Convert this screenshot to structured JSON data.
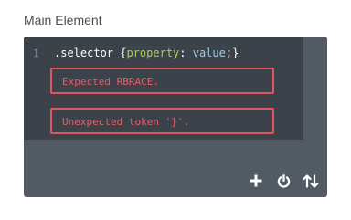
{
  "section": {
    "title": "Main Element"
  },
  "editor": {
    "line_number": "1",
    "code": {
      "selector": ".selector",
      "open_brace": " {",
      "property": "property",
      "colon": ": ",
      "value": "value",
      "semicolon": ";",
      "close_brace": "}"
    },
    "errors": [
      "Expected RBRACE.",
      "Unexpected token '}'."
    ]
  },
  "toolbar": {
    "icons": [
      "plus-icon",
      "power-icon",
      "sort-icon"
    ]
  },
  "colors": {
    "editor_bg": "#3c4249",
    "toolbar_bg": "#525a63",
    "error": "#e25560",
    "property": "#a6d25a",
    "value": "#8fd0ea"
  }
}
